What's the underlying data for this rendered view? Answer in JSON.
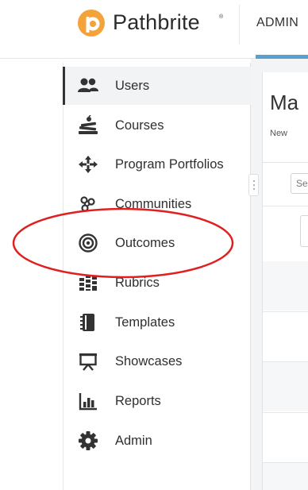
{
  "header": {
    "brand": "Pathbrite",
    "brand_mark": "®",
    "tab": "ADMIN",
    "accent": "#5aa0cf",
    "logo_color": "#f4a23a"
  },
  "sidebar": {
    "items": [
      {
        "label": "Users",
        "icon": "users-icon",
        "active": true
      },
      {
        "label": "Courses",
        "icon": "courses-icon"
      },
      {
        "label": "Program Portfolios",
        "icon": "program-portfolios-icon"
      },
      {
        "label": "Communities",
        "icon": "communities-icon"
      },
      {
        "label": "Outcomes",
        "icon": "outcomes-icon"
      },
      {
        "label": "Rubrics",
        "icon": "rubrics-icon"
      },
      {
        "label": "Templates",
        "icon": "templates-icon"
      },
      {
        "label": "Showcases",
        "icon": "showcases-icon"
      },
      {
        "label": "Reports",
        "icon": "reports-icon"
      },
      {
        "label": "Admin",
        "icon": "gear-icon"
      }
    ]
  },
  "main": {
    "title": "Ma",
    "subtitle": "New",
    "search_placeholder": "Se"
  },
  "annotation": {
    "color": "#e0201f"
  }
}
